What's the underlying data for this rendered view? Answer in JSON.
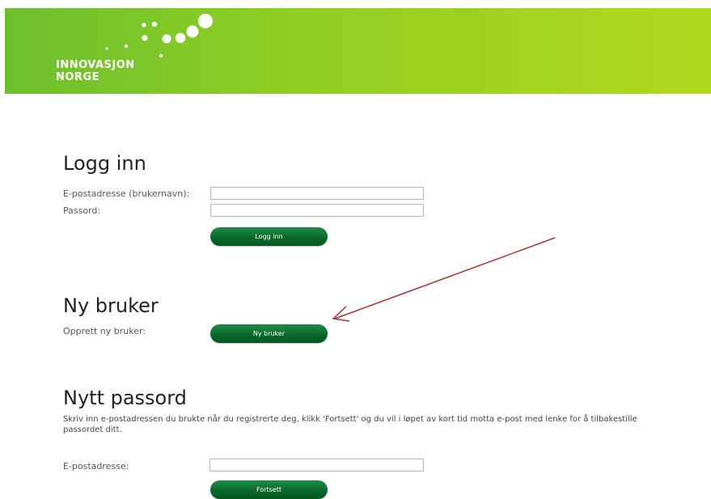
{
  "header": {
    "logo_line1": "INNOVASJON",
    "logo_line2": "NORGE",
    "brand_colors": {
      "gradient_start": "#6cbf2e",
      "gradient_end": "#b2d81d",
      "button_green": "#0a6a2c"
    }
  },
  "login": {
    "title": "Logg inn",
    "email_label": "E-postadresse (brukernavn):",
    "email_value": "",
    "password_label": "Passord:",
    "password_value": "",
    "submit_label": "Logg inn"
  },
  "new_user": {
    "title": "Ny bruker",
    "label": "Opprett ny bruker:",
    "button_label": "Ny bruker"
  },
  "new_password": {
    "title": "Nytt passord",
    "description": "Skriv inn e-postadressen du brukte når du registrerte deg, klikk 'Fortsett' og du vil i løpet av kort tid motta e-post med lenke for å tilbakestille passordet ditt.",
    "email_label": "E-postadresse:",
    "email_value": "",
    "button_label": "Fortsett"
  },
  "annotation": {
    "arrow_color": "#a8322d",
    "arrow_target": "new-user-button"
  }
}
